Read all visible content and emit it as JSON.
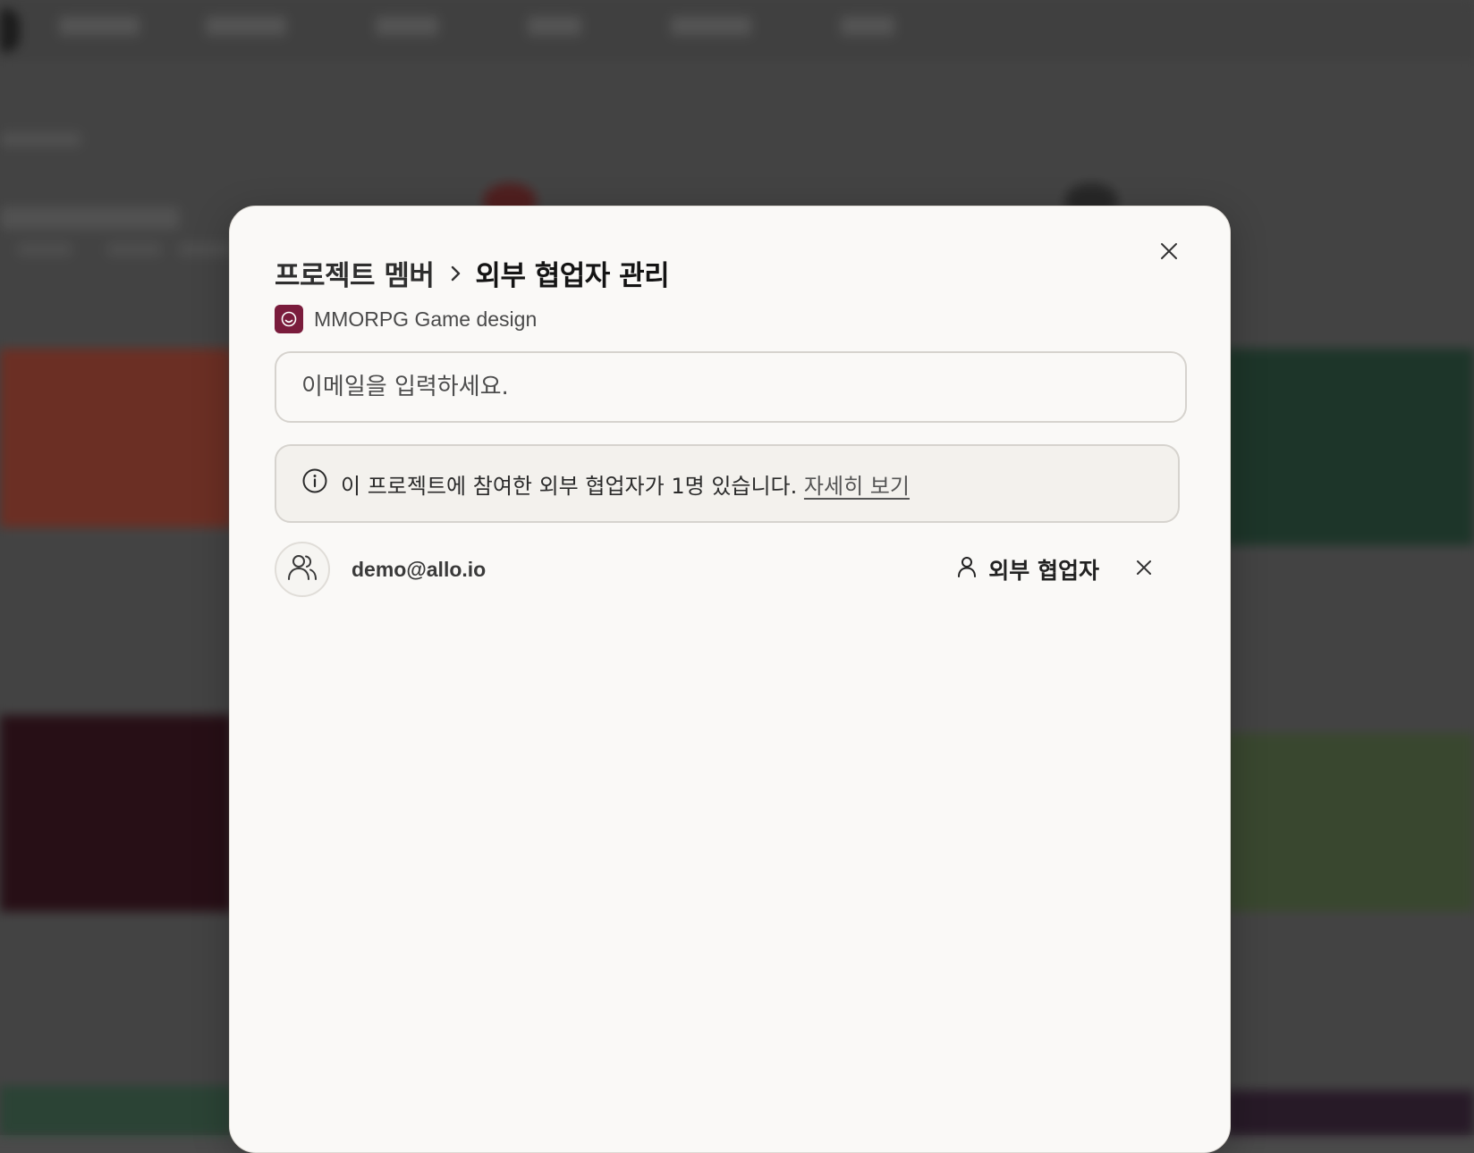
{
  "modal": {
    "breadcrumb_parent": "프로젝트 멤버",
    "breadcrumb_current": "외부 협업자 관리",
    "project_name": "MMORPG Game design",
    "email_placeholder": "이메일을 입력하세요.",
    "info_text": "이 프로젝트에 참여한 외부 협업자가 1명 있습니다.",
    "info_link": "자세히 보기",
    "members": [
      {
        "email": "demo@allo.io",
        "role": "외부 협업자"
      }
    ]
  },
  "colors": {
    "project_icon": "#7a1c3c",
    "modal_bg": "#faf9f7",
    "info_bg": "#f3f1ed"
  },
  "icons": {
    "close": "close-icon",
    "chevron": "chevron-right-icon",
    "project": "smiley-icon",
    "info": "info-icon",
    "avatar": "users-icon",
    "role": "user-icon",
    "remove": "remove-icon"
  }
}
